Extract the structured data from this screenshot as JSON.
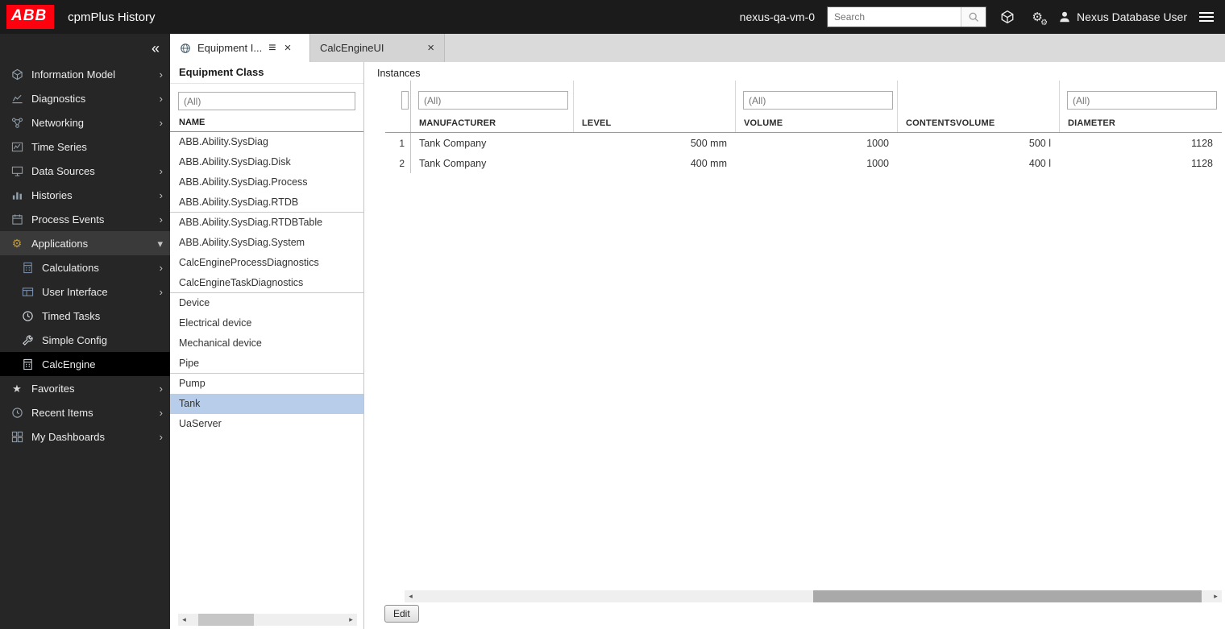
{
  "glyphs": {
    "collapse": "«",
    "chevron_right": "›",
    "chevron_down": "▾",
    "close": "×",
    "tab_menu": "≡",
    "gear": "⚙",
    "star": "★",
    "scroll_left": "◂",
    "scroll_right": "▸"
  },
  "colors": {
    "brand_red": "#ff000f",
    "selection_blue": "#b8cde9",
    "topbar_bg": "#1b1b1b",
    "sidebar_bg": "#262626"
  },
  "topbar": {
    "logo": "ABB",
    "title": "cpmPlus History",
    "server": "nexus-qa-vm-0",
    "search_placeholder": "Search",
    "user": "Nexus Database User"
  },
  "sidebar": {
    "items": [
      {
        "label": "Information Model"
      },
      {
        "label": "Diagnostics"
      },
      {
        "label": "Networking"
      },
      {
        "label": "Time Series"
      },
      {
        "label": "Data Sources"
      },
      {
        "label": "Histories"
      },
      {
        "label": "Process Events"
      },
      {
        "label": "Applications"
      },
      {
        "label": "Calculations"
      },
      {
        "label": "User Interface"
      },
      {
        "label": "Timed Tasks"
      },
      {
        "label": "Simple Config"
      },
      {
        "label": "CalcEngine"
      },
      {
        "label": "Favorites"
      },
      {
        "label": "Recent Items"
      },
      {
        "label": "My Dashboards"
      }
    ]
  },
  "tabs": [
    {
      "label": "Equipment I..."
    },
    {
      "label": "CalcEngineUI"
    }
  ],
  "equipment_class": {
    "title": "Equipment Class",
    "filter_placeholder": "(All)",
    "name_header": "NAME",
    "items": [
      "ABB.Ability.SysDiag",
      "ABB.Ability.SysDiag.Disk",
      "ABB.Ability.SysDiag.Process",
      "ABB.Ability.SysDiag.RTDB",
      "ABB.Ability.SysDiag.RTDBTable",
      "ABB.Ability.SysDiag.System",
      "CalcEngineProcessDiagnostics",
      "CalcEngineTaskDiagnostics",
      "Device",
      "Electrical device",
      "Mechanical device",
      "Pipe",
      "Pump",
      "Tank",
      "UaServer"
    ],
    "selected_item": "Tank"
  },
  "instances": {
    "title": "Instances",
    "filter_placeholder": "(All)",
    "columns": [
      "MANUFACTURER",
      "LEVEL",
      "VOLUME",
      "CONTENTSVOLUME",
      "DIAMETER"
    ],
    "rows": [
      {
        "num": "1",
        "values": [
          "Tank Company",
          "500 mm",
          "1000",
          "500 l",
          "1128"
        ]
      },
      {
        "num": "2",
        "values": [
          "Tank Company",
          "400 mm",
          "1000",
          "400 l",
          "1128"
        ]
      }
    ],
    "edit_button": "Edit"
  }
}
